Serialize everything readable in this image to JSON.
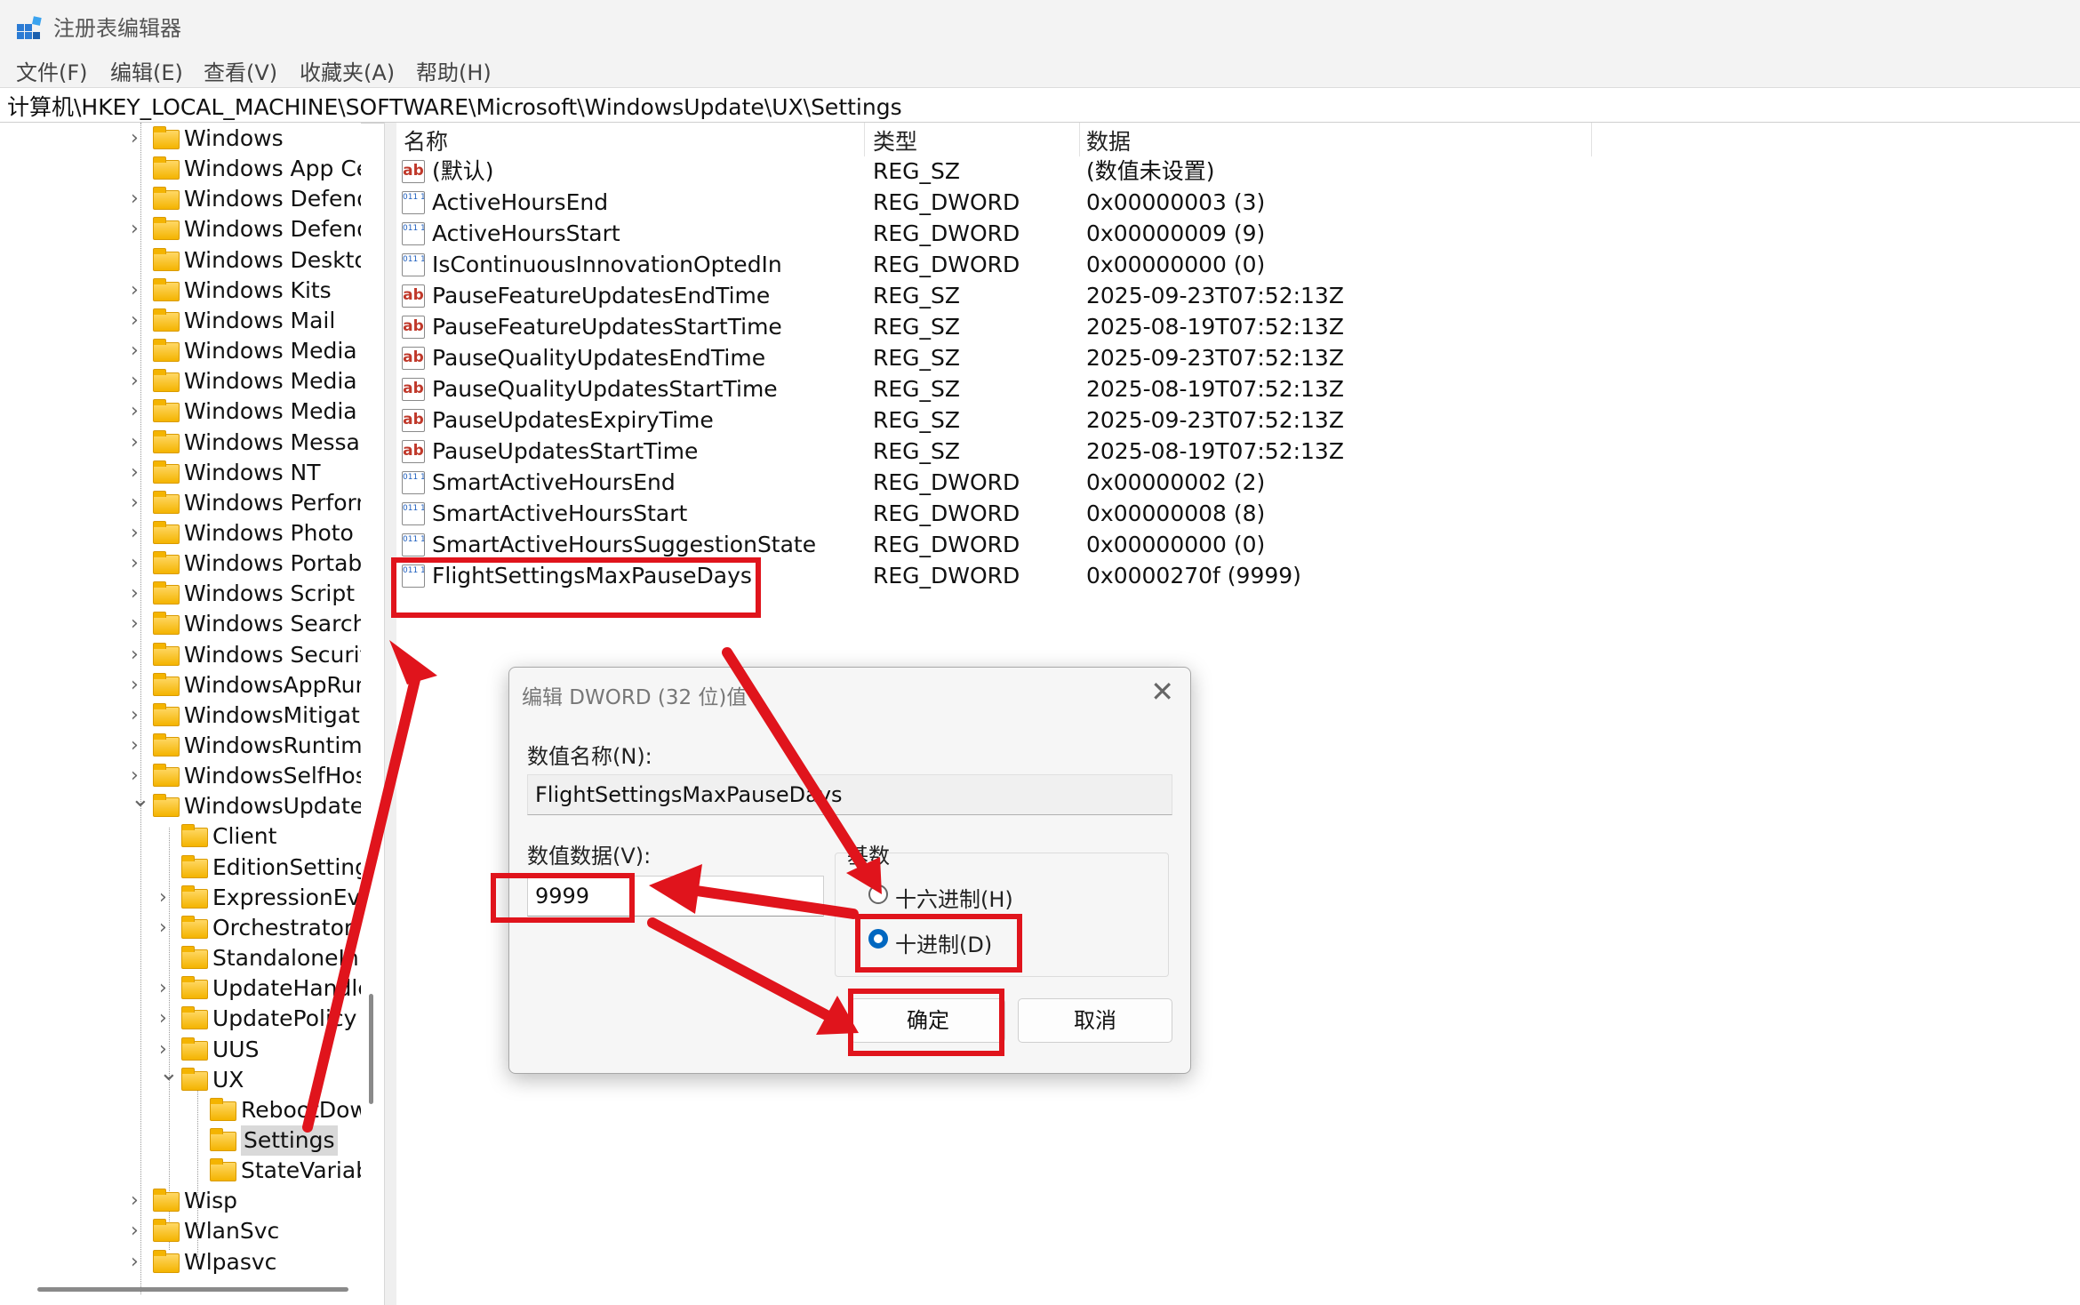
{
  "window": {
    "title": "注册表编辑器"
  },
  "menu": [
    "文件(F)",
    "编辑(E)",
    "查看(V)",
    "收藏夹(A)",
    "帮助(H)"
  ],
  "address": "计算机\\HKEY_LOCAL_MACHINE\\SOFTWARE\\Microsoft\\WindowsUpdate\\UX\\Settings",
  "tree": [
    {
      "label": "Windows",
      "chevron": ">"
    },
    {
      "label": "Windows App Ce",
      "chevron": ""
    },
    {
      "label": "Windows Defend",
      "chevron": ">"
    },
    {
      "label": "Windows Defend",
      "chevron": ">"
    },
    {
      "label": "Windows Deskto",
      "chevron": ""
    },
    {
      "label": "Windows Kits",
      "chevron": ">"
    },
    {
      "label": "Windows Mail",
      "chevron": ">"
    },
    {
      "label": "Windows Media I",
      "chevron": ">"
    },
    {
      "label": "Windows Media I",
      "chevron": ">"
    },
    {
      "label": "Windows Media I",
      "chevron": ">"
    },
    {
      "label": "Windows Messag",
      "chevron": ">"
    },
    {
      "label": "Windows NT",
      "chevron": ">"
    },
    {
      "label": "Windows Perform",
      "chevron": ">"
    },
    {
      "label": "Windows Photo V",
      "chevron": ">"
    },
    {
      "label": "Windows Portabl",
      "chevron": ">"
    },
    {
      "label": "Windows Script H",
      "chevron": ">"
    },
    {
      "label": "Windows Search",
      "chevron": ">"
    },
    {
      "label": "Windows Security",
      "chevron": ">"
    },
    {
      "label": "WindowsAppRun",
      "chevron": ">"
    },
    {
      "label": "WindowsMitigati",
      "chevron": ">"
    },
    {
      "label": "WindowsRuntime",
      "chevron": ">"
    },
    {
      "label": "WindowsSelfHost",
      "chevron": ">"
    },
    {
      "label": "WindowsUpdate",
      "chevron": "v"
    },
    {
      "label": "Client",
      "chevron": ""
    },
    {
      "label": "EditionSetting",
      "chevron": ""
    },
    {
      "label": "ExpressionEva",
      "chevron": ">"
    },
    {
      "label": "Orchestrator",
      "chevron": ">"
    },
    {
      "label": "StandaloneIn",
      "chevron": ""
    },
    {
      "label": "UpdateHandle",
      "chevron": ">"
    },
    {
      "label": "UpdatePolicy",
      "chevron": ">"
    },
    {
      "label": "UUS",
      "chevron": ">"
    },
    {
      "label": "UX",
      "chevron": "v"
    },
    {
      "label": "RebootDow",
      "chevron": ""
    },
    {
      "label": "Settings",
      "chevron": "",
      "selected": true
    },
    {
      "label": "StateVariab",
      "chevron": ""
    },
    {
      "label": "Wisp",
      "chevron": ">"
    },
    {
      "label": "WlanSvc",
      "chevron": ">"
    },
    {
      "label": "Wlpasvc",
      "chevron": ">"
    }
  ],
  "columns": {
    "name": "名称",
    "type": "类型",
    "data": "数据"
  },
  "values": [
    {
      "icon": "string",
      "name": "(默认)",
      "type": "REG_SZ",
      "data": "(数值未设置)"
    },
    {
      "icon": "binary",
      "name": "ActiveHoursEnd",
      "type": "REG_DWORD",
      "data": "0x00000003 (3)"
    },
    {
      "icon": "binary",
      "name": "ActiveHoursStart",
      "type": "REG_DWORD",
      "data": "0x00000009 (9)"
    },
    {
      "icon": "binary",
      "name": "IsContinuousInnovationOptedIn",
      "type": "REG_DWORD",
      "data": "0x00000000 (0)"
    },
    {
      "icon": "string",
      "name": "PauseFeatureUpdatesEndTime",
      "type": "REG_SZ",
      "data": "2025-09-23T07:52:13Z"
    },
    {
      "icon": "string",
      "name": "PauseFeatureUpdatesStartTime",
      "type": "REG_SZ",
      "data": "2025-08-19T07:52:13Z"
    },
    {
      "icon": "string",
      "name": "PauseQualityUpdatesEndTime",
      "type": "REG_SZ",
      "data": "2025-09-23T07:52:13Z"
    },
    {
      "icon": "string",
      "name": "PauseQualityUpdatesStartTime",
      "type": "REG_SZ",
      "data": "2025-08-19T07:52:13Z"
    },
    {
      "icon": "string",
      "name": "PauseUpdatesExpiryTime",
      "type": "REG_SZ",
      "data": "2025-09-23T07:52:13Z"
    },
    {
      "icon": "string",
      "name": "PauseUpdatesStartTime",
      "type": "REG_SZ",
      "data": "2025-08-19T07:52:13Z"
    },
    {
      "icon": "binary",
      "name": "SmartActiveHoursEnd",
      "type": "REG_DWORD",
      "data": "0x00000002 (2)"
    },
    {
      "icon": "binary",
      "name": "SmartActiveHoursStart",
      "type": "REG_DWORD",
      "data": "0x00000008 (8)"
    },
    {
      "icon": "binary",
      "name": "SmartActiveHoursSuggestionState",
      "type": "REG_DWORD",
      "data": "0x00000000 (0)"
    },
    {
      "icon": "binary",
      "name": "FlightSettingsMaxPauseDays",
      "type": "REG_DWORD",
      "data": "0x0000270f (9999)"
    }
  ],
  "icon_text": {
    "string": "ab",
    "binary": "011 110"
  },
  "dialog": {
    "title": "编辑 DWORD (32 位)值",
    "close_glyph": "✕",
    "value_name_label": "数值名称(N):",
    "value_name": "FlightSettingsMaxPauseDays",
    "value_data_label": "数值数据(V):",
    "value_data": "9999",
    "base_label": "基数",
    "hex_label": "十六进制(H)",
    "dec_label": "十进制(D)",
    "base_selected": "decimal",
    "ok_label": "确定",
    "cancel_label": "取消"
  },
  "colors": {
    "annotation_red": "#e0141c",
    "radio_accent": "#0067c0",
    "folder_yellow": "#f4b400"
  }
}
